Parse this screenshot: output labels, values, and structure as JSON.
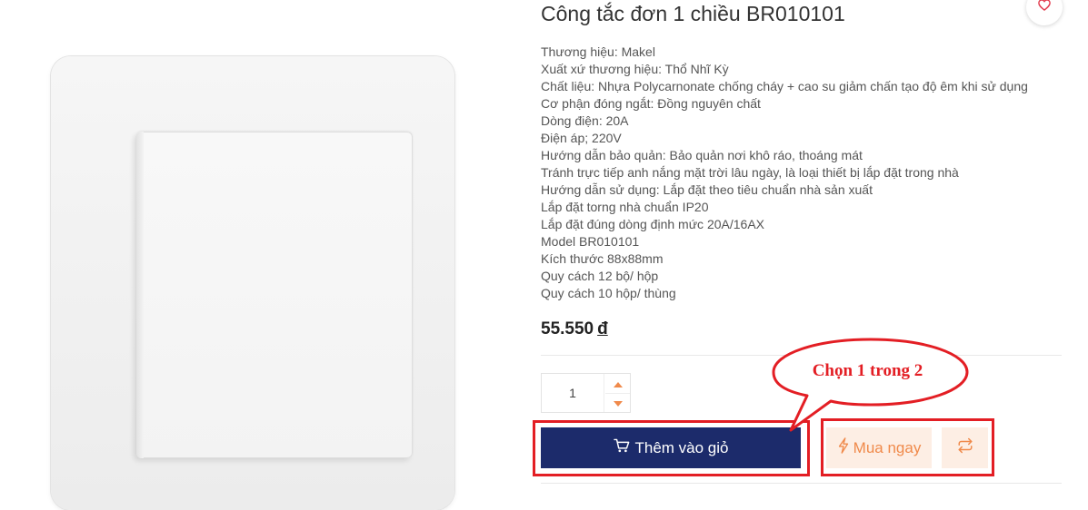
{
  "product": {
    "title": "Công tắc đơn 1 chiều BR010101",
    "specs": [
      "Thương hiệu: Makel",
      "Xuất xứ thương hiệu: Thổ Nhĩ Kỳ",
      "Chất liệu: Nhựa Polycarnonate chống cháy + cao su giảm chấn tạo độ êm khi sử dụng",
      "Cơ phận đóng ngắt: Đồng nguyên chất",
      "Dòng điện: 20A",
      "Điện áp; 220V",
      "Hướng dẫn bảo quản: Bảo quản nơi khô ráo, thoáng mát",
      "Tránh trực tiếp anh nắng mặt trời lâu ngày, là loại thiết bị lắp đặt trong nhà",
      "Hướng dẫn sử dụng: Lắp đặt theo tiêu chuẩn nhà sản xuất",
      "Lắp đặt torng nhà chuẩn IP20",
      "Lắp đặt đúng dòng định mức 20A/16AX",
      "Model BR010101",
      "Kích thước 88x88mm",
      "Quy cách 12 bộ/ hộp",
      "Quy cách 10 hộp/ thùng"
    ],
    "price": "55.550",
    "currency": "đ"
  },
  "quantity": {
    "value": "1"
  },
  "actions": {
    "add_to_cart": "Thêm vào giỏ",
    "buy_now": "Mua ngay"
  },
  "annotation": {
    "callout": "Chọn 1 trong 2",
    "color": "#e31e24"
  },
  "icons": {
    "wishlist": "heart-icon",
    "cart": "cart-icon",
    "buy": "lightning-icon",
    "compare": "repeat-icon",
    "qty_up": "caret-up-icon",
    "qty_down": "caret-down-icon"
  },
  "colors": {
    "primary": "#1c2b6b",
    "accent": "#f08a4b",
    "accent_bg": "#fdeee4"
  }
}
